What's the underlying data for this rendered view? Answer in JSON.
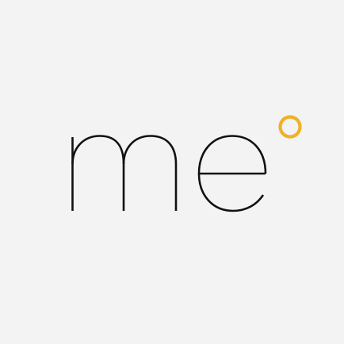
{
  "logo": {
    "wordmark": "me",
    "ink_color": "#111111",
    "accent_color": "#f0b224",
    "background_color": "#f3f3f3",
    "icon": "degree-ring-icon"
  }
}
